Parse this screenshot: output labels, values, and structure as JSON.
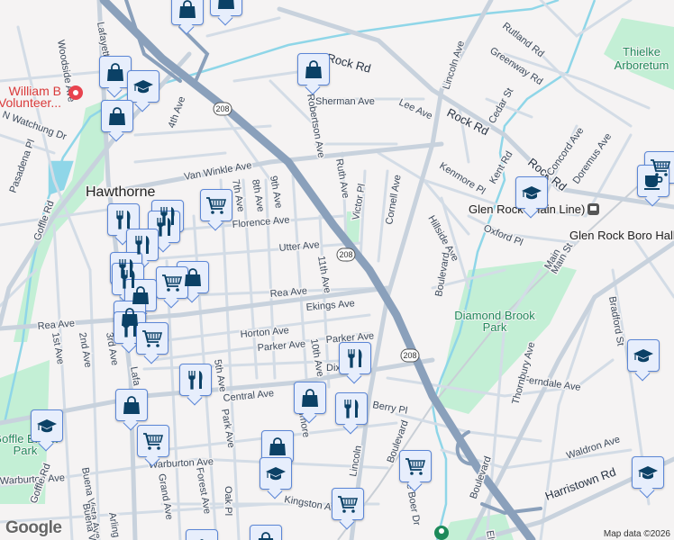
{
  "map": {
    "attribution": "Map data ©2026",
    "logo": "Google",
    "route_shield": "208",
    "colors": {
      "background": "#f5f3f3",
      "road": "#d3dce6",
      "highway": "#8aa0bb",
      "park": "#c3efd5",
      "water": "#8fd6e8",
      "marker_fill": "#e7eefc",
      "marker_border": "#5b86d6",
      "marker_icon": "#0b4166",
      "poi_red": "#e8434e"
    }
  },
  "places": {
    "city": "Hawthorne",
    "poi": "William B Volunteer...",
    "station": "Glen Rock (Main Line)",
    "boro_hall": "Glen Rock Boro Hall",
    "parks": [
      "Thielke Arboretum",
      "Diamond Brook Park",
      "Goffle Brook Park"
    ]
  },
  "streets": [
    "Rock Rd",
    "Rock Rd",
    "Rock Rd",
    "Lincoln Ave",
    "Lincoln",
    "Sherman Ave",
    "Lee Ave",
    "Rutland Rd",
    "Greenway Rd",
    "Cedar St",
    "Kenmore Pl",
    "Kent Rd",
    "Concord Ave",
    "Doremus Ave",
    "Van Winkle Ave",
    "Robertson Ave",
    "Ruth Ave",
    "Victor Pl",
    "Cornell Ave",
    "Hillside Ave",
    "Oxford Pl",
    "Florence Ave",
    "Utter Ave",
    "Rea Ave",
    "Rea Ave",
    "Ekings Ave",
    "Horton Ave",
    "Parker Ave",
    "Parker Ave",
    "Central Ave",
    "Berry Pl",
    "Ferndale Ave",
    "Waldron Ave",
    "Harristown Rd",
    "Warburton Ave",
    "Warburton Ave",
    "Kingston Ave",
    "Goffle Rd",
    "N Watchung Dr",
    "Pasadena Pl",
    "Woodside Ave",
    "Lafayette",
    "Lafa",
    "4th Ave",
    "7th Ave",
    "8th Ave",
    "9th Ave",
    "10th Ave",
    "11th Ave",
    "5th Ave",
    "Park Ave",
    "Forest Ave",
    "Oak Pl",
    "Grand Ave",
    "1st Ave",
    "2nd Ave",
    "3rd Ave",
    "Buena Vista Ave",
    "Buena V",
    "Arling",
    "Boulevard",
    "Boulevard",
    "Boulevard",
    "De Boer Dr",
    "Thornbury Ave",
    "Bradford St",
    "Main St",
    "Goffle Rd",
    "Elm",
    "Dix",
    "Fillmore",
    "Main"
  ],
  "markers": [
    {
      "type": "shopping",
      "icon": "shopping-bag-icon"
    },
    {
      "type": "shopping",
      "icon": "shopping-bag-icon"
    },
    {
      "type": "shopping",
      "icon": "shopping-bag-icon"
    },
    {
      "type": "school",
      "icon": "graduation-cap-icon"
    },
    {
      "type": "shopping",
      "icon": "shopping-bag-icon"
    },
    {
      "type": "shopping",
      "icon": "shopping-bag-icon"
    },
    {
      "type": "grocery",
      "icon": "shopping-cart-icon"
    },
    {
      "type": "restaurant",
      "icon": "fork-knife-icon"
    },
    {
      "type": "restaurant",
      "icon": "fork-knife-icon"
    },
    {
      "type": "restaurant",
      "icon": "fork-knife-icon"
    },
    {
      "type": "restaurant",
      "icon": "fork-knife-icon"
    },
    {
      "type": "restaurant",
      "icon": "fork-knife-icon"
    },
    {
      "type": "restaurant",
      "icon": "fork-knife-icon"
    },
    {
      "type": "shopping",
      "icon": "shopping-bag-icon"
    },
    {
      "type": "grocery",
      "icon": "shopping-cart-icon"
    },
    {
      "type": "shopping",
      "icon": "shopping-bag-icon"
    },
    {
      "type": "shopping",
      "icon": "shopping-bag-icon"
    },
    {
      "type": "restaurant",
      "icon": "fork-knife-icon"
    },
    {
      "type": "grocery",
      "icon": "shopping-cart-icon"
    },
    {
      "type": "restaurant",
      "icon": "fork-knife-icon"
    },
    {
      "type": "shopping",
      "icon": "shopping-bag-icon"
    },
    {
      "type": "grocery",
      "icon": "shopping-cart-icon"
    },
    {
      "type": "school",
      "icon": "graduation-cap-icon"
    },
    {
      "type": "shopping",
      "icon": "shopping-bag-icon"
    },
    {
      "type": "restaurant",
      "icon": "fork-knife-icon"
    },
    {
      "type": "restaurant",
      "icon": "fork-knife-icon"
    },
    {
      "type": "shopping",
      "icon": "shopping-bag-icon"
    },
    {
      "type": "school",
      "icon": "graduation-cap-icon"
    },
    {
      "type": "grocery",
      "icon": "shopping-cart-icon"
    },
    {
      "type": "grocery",
      "icon": "shopping-cart-icon"
    },
    {
      "type": "school",
      "icon": "graduation-cap-icon"
    },
    {
      "type": "grocery",
      "icon": "shopping-cart-icon"
    },
    {
      "type": "cafe",
      "icon": "coffee-cup-icon"
    },
    {
      "type": "school",
      "icon": "graduation-cap-icon"
    },
    {
      "type": "school",
      "icon": "graduation-cap-icon"
    },
    {
      "type": "school",
      "icon": "graduation-cap-icon"
    },
    {
      "type": "shopping",
      "icon": "shopping-bag-icon"
    }
  ]
}
